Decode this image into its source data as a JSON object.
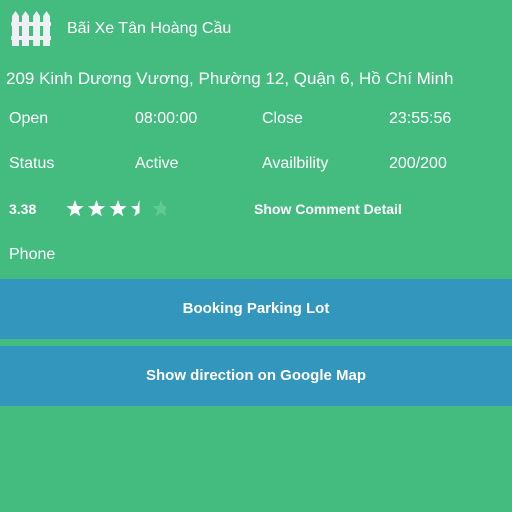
{
  "header": {
    "logo_icon": "fence-icon",
    "title": "Bãi Xe Tân Hoàng Cầu"
  },
  "address": "209 Kinh Dương Vương, Phường 12, Quận 6, Hồ Chí Minh",
  "details": {
    "open_label": "Open",
    "open_value": "08:00:00",
    "close_label": "Close",
    "close_value": "23:55:56",
    "status_label": "Status",
    "status_value": "Active",
    "availability_label": "Availbility",
    "availability_value": "200/200"
  },
  "rating": {
    "value": "3.38",
    "stars_filled": 3.5,
    "stars_total": 5,
    "star_icon": "star-icon",
    "show_comment_label": "Show Comment Detail"
  },
  "phone_label": "Phone",
  "actions": {
    "booking_label": "Booking Parking Lot",
    "direction_label": "Show direction on Google Map"
  },
  "colors": {
    "background": "#44bc80",
    "button": "#3396bd",
    "text": "#ffffff",
    "star_empty": "#5ecb95"
  }
}
